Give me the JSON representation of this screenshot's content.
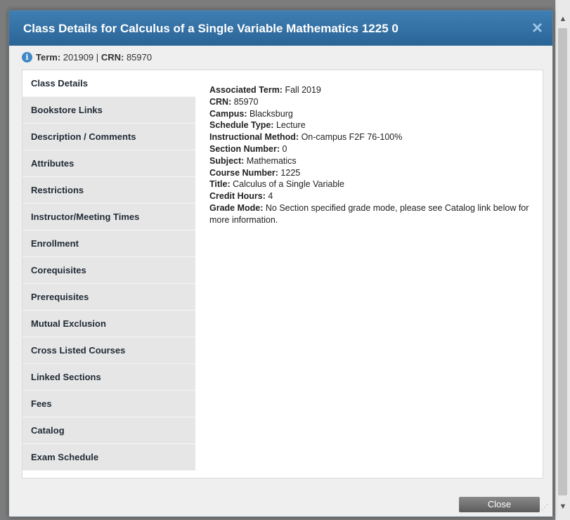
{
  "dialog": {
    "title": "Class Details for Calculus of a Single Variable Mathematics 1225 0",
    "close_icon": "×",
    "info": {
      "term_label": "Term:",
      "term_value": "201909",
      "separator": "|",
      "crn_label": "CRN:",
      "crn_value": "85970"
    },
    "tabs": [
      {
        "label": "Class Details",
        "active": true
      },
      {
        "label": "Bookstore Links"
      },
      {
        "label": "Description / Comments"
      },
      {
        "label": "Attributes"
      },
      {
        "label": "Restrictions"
      },
      {
        "label": "Instructor/Meeting Times"
      },
      {
        "label": "Enrollment"
      },
      {
        "label": "Corequisites"
      },
      {
        "label": "Prerequisites"
      },
      {
        "label": "Mutual Exclusion"
      },
      {
        "label": "Cross Listed Courses"
      },
      {
        "label": "Linked Sections"
      },
      {
        "label": "Fees"
      },
      {
        "label": "Catalog"
      },
      {
        "label": "Exam Schedule"
      }
    ],
    "details": [
      {
        "label": "Associated Term:",
        "value": "Fall 2019"
      },
      {
        "label": "CRN:",
        "value": "85970"
      },
      {
        "label": "Campus:",
        "value": "Blacksburg"
      },
      {
        "label": "Schedule Type:",
        "value": "Lecture"
      },
      {
        "label": "Instructional Method:",
        "value": "On-campus F2F 76-100%"
      },
      {
        "label": "Section Number:",
        "value": "0"
      },
      {
        "label": "Subject:",
        "value": "Mathematics"
      },
      {
        "label": "Course Number:",
        "value": "1225"
      },
      {
        "label": "Title:",
        "value": "Calculus of a Single Variable"
      },
      {
        "label": "Credit Hours:",
        "value": "4"
      },
      {
        "label": "Grade Mode:",
        "value": "No Section specified grade mode, please see Catalog link below for more information."
      }
    ],
    "close_button": "Close"
  },
  "colors": {
    "titlebar": "#2f6fa5",
    "tab_bg": "#e6e6e6",
    "info_icon": "#3f88c5"
  }
}
